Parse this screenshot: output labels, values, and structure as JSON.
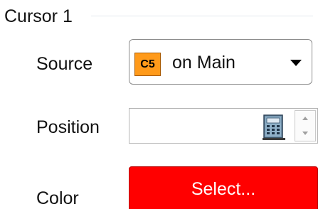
{
  "group": {
    "title": "Cursor 1"
  },
  "source": {
    "label": "Source",
    "channel_badge": "C5",
    "badge_color": "#ff9a1a",
    "value": "on Main",
    "arrow_icon": "chevron-down-icon"
  },
  "position": {
    "label": "Position",
    "value": "",
    "calculator_icon": "calculator-icon"
  },
  "color": {
    "label": "Color",
    "button_label": "Select...",
    "swatch": "#ff0000"
  }
}
